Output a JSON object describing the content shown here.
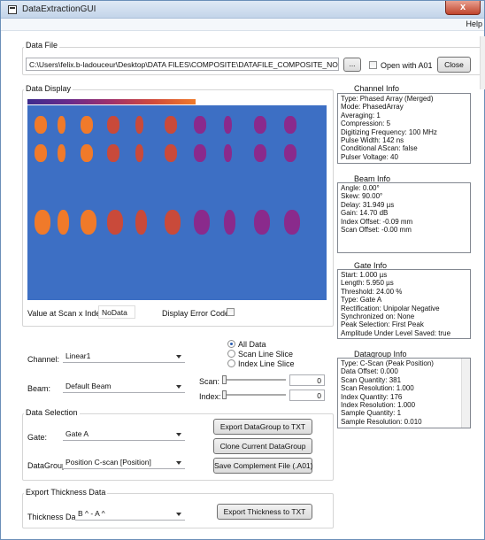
{
  "window": {
    "title": "DataExtractionGUI",
    "close_symbol": "x"
  },
  "menu": {
    "help": "Help"
  },
  "data_file": {
    "group_label": "Data File",
    "path": "C:\\Users\\felix.b-ladouceur\\Desktop\\DATA FILES\\COMPOSITE\\DATAFILE_COMPOSITE_NORMAL_",
    "browse_label": "...",
    "open_with_label": "Open with A01",
    "close_label": "Close"
  },
  "data_display": {
    "group_label": "Data Display",
    "value_label": "Value at Scan x Index:",
    "value": "NoData",
    "error_codes_label": "Display Error Codes"
  },
  "channel_info": {
    "label": "Channel Info",
    "lines": [
      "Type: Phased Array (Merged)",
      "Mode: PhasedArray",
      "Averaging: 1",
      "Compression: 5",
      "Digitizing Frequency: 100 MHz",
      "Pulse Width: 142 ns",
      "Conditional AScan: false",
      "Pulser Voltage: 40"
    ]
  },
  "beam_info": {
    "label": "Beam Info",
    "lines": [
      "Angle: 0.00°",
      "Skew: 90.00°",
      "Delay: 31.949 µs",
      "Gain: 14.70 dB",
      "Index Offset: -0.09 mm",
      "Scan Offset: -0.00 mm"
    ]
  },
  "gate_info": {
    "label": "Gate Info",
    "lines": [
      "Start: 1.000 µs",
      "Length: 5.950 µs",
      "Threshold: 24.00 %",
      "Type: Gate A",
      "Rectification: Unipolar Negative",
      "Synchronized on: None",
      "Peak Selection: First Peak",
      "Amplitude Under Level Saved: true"
    ]
  },
  "datagroup_info": {
    "label": "Datagroup Info",
    "lines": [
      "Type: C-Scan (Peak Position)",
      "Data Offset: 0.000",
      "Scan Quantity: 381",
      "Scan Resolution: 1.000",
      "Index Quantity: 176",
      "Index Resolution: 1.000",
      "Sample Quantity: 1",
      "Sample Resolution: 0.010"
    ]
  },
  "selection": {
    "channel_label": "Channel:",
    "channel_value": "Linear1",
    "beam_label": "Beam:",
    "beam_value": "Default Beam",
    "radio_all": "All Data",
    "radio_scan": "Scan Line Slice",
    "radio_index": "Index Line Slice",
    "scan_label": "Scan:",
    "scan_value": "0",
    "index_label": "Index:",
    "index_value": "0"
  },
  "data_selection": {
    "group_label": "Data Selection",
    "gate_label": "Gate:",
    "gate_value": "Gate A",
    "datagroup_label": "DataGroup:",
    "datagroup_value": "Position C-scan [Position]",
    "export_label": "Export DataGroup to TXT",
    "clone_label": "Clone Current DataGroup",
    "save_label": "Save Complement File (.A01)"
  },
  "thickness": {
    "group_label": "Export Thickness Data",
    "data_label": "Thickness Data:",
    "data_value": "B ^ - A ^",
    "export_label": "Export Thickness to TXT"
  },
  "colors": {
    "plot_bg": "#3d6fc4",
    "orange": "#f07a2a",
    "red": "#c94a3a",
    "purple": "#8a2a8c"
  }
}
